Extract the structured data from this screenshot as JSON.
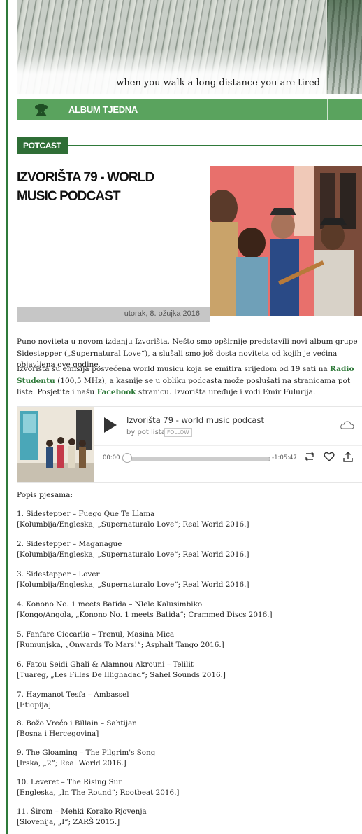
{
  "banner": {
    "caption": "when you walk a long distance you are tired"
  },
  "album_bar": {
    "label": "ALBUM TJEDNA",
    "icon": "album-award-icon"
  },
  "section_tag": "POTCAST",
  "article": {
    "title": "IZVORIŠTA 79 - WORLD MUSIC PODCAST",
    "date": "utorak, 8. ožujka 2016",
    "para1": "Puno noviteta u novom izdanju Izvorišta. Nešto smo opširnije predstavili novi album grupe Sidestepper („Supernatural Love“), a slušali smo još dosta noviteta od kojih je većina objavljena ove godine.",
    "para2_a": "Izvorišta su emisija posvećena world musicu koja se emitira srijedom od 19 sati na ",
    "para2_link1": "Radio Studentu",
    "para2_b": " (100,5 MHz), a kasnije se u obliku podcasta može poslušati na stranicama pot liste. Posjetite i našu ",
    "para2_link2": "Facebook",
    "para2_c": " stranicu. Izvorišta uređuje i vodi Emir Fulurija."
  },
  "player": {
    "title": "Izvorišta 79 - world music podcast",
    "by": "by pot lista",
    "follow": "FOLLOW",
    "time_start": "00:00",
    "time_remaining": "-1:05:47",
    "progress": 0
  },
  "tracklist": {
    "heading": "Popis pjesama:",
    "items": [
      {
        "line1": "1. Sidestepper – Fuego Que Te Llama",
        "line2": "[Kolumbija/Engleska, „Supernaturalo Love“; Real World 2016.]"
      },
      {
        "line1": "2. Sidestepper – Maganague",
        "line2": "[Kolumbija/Engleska, „Supernaturalo Love“; Real World 2016.]"
      },
      {
        "line1": "3. Sidestepper – Lover",
        "line2": "[Kolumbija/Engleska, „Supernaturalo Love“; Real World 2016.]"
      },
      {
        "line1": "4. Konono No. 1 meets Batida – Nlele Kalusimbiko",
        "line2": "[Kongo/Angola, „Konono No. 1 meets Batida“; Crammed Discs 2016.]"
      },
      {
        "line1": "5. Fanfare Ciocarlia – Trenul, Masina Mica",
        "line2": "[Rumunjska, „Onwards To Mars!“; Asphalt Tango 2016.]"
      },
      {
        "line1": "6. Fatou Seidi Ghali & Alamnou Akrouni – Telilit",
        "line2": "[Tuareg, „Les Filles De Illighadad“; Sahel Sounds 2016.]"
      },
      {
        "line1": "7. Haymanot Tesfa – Ambassel",
        "line2": "[Etiopija]"
      },
      {
        "line1": "8. Božo Vrećo i Billain – Sahtijan",
        "line2": "[Bosna i Hercegovina]"
      },
      {
        "line1": "9. The Gloaming – The Pilgrim's Song",
        "line2": "[Irska, „2“; Real World 2016.]"
      },
      {
        "line1": "10. Leveret – The Rising Sun",
        "line2": "[Engleska, „In The Round“; Rootbeat 2016.]"
      },
      {
        "line1": "11. Širom – Mehki Korako Rjovenja",
        "line2": "[Slovenija, „I“; ZARŠ 2015.]"
      }
    ]
  },
  "colors": {
    "brand_green": "#2f7a3a",
    "bar_green": "#5aa35e",
    "tag_green": "#2f6e36"
  }
}
